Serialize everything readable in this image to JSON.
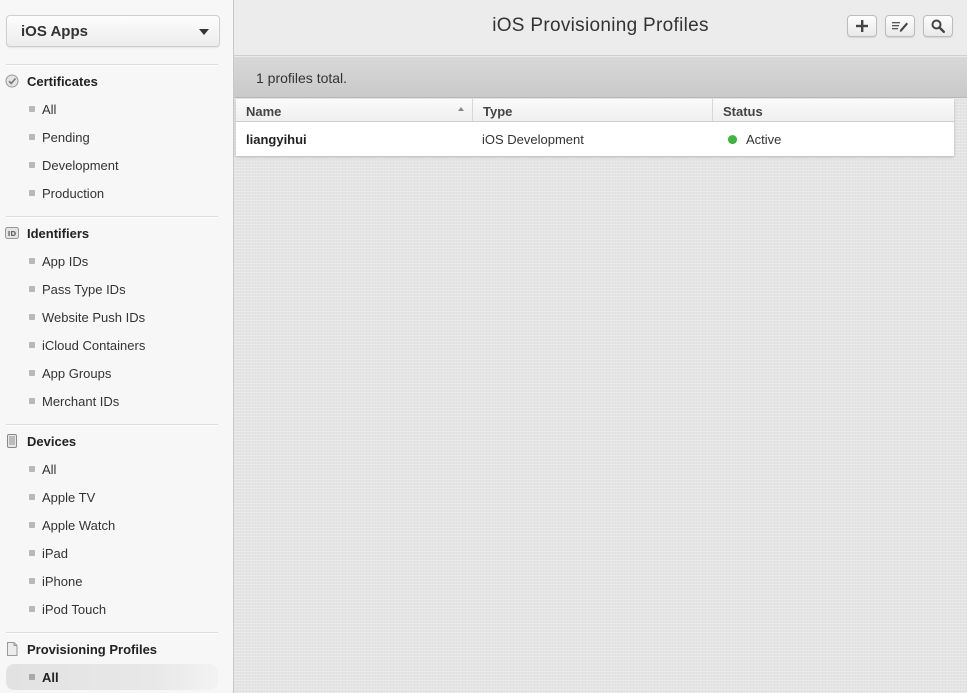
{
  "sidebar": {
    "app_select": "iOS Apps",
    "sections": [
      {
        "title": "Certificates",
        "icon": "certificate-icon",
        "items": [
          "All",
          "Pending",
          "Development",
          "Production"
        ]
      },
      {
        "title": "Identifiers",
        "icon": "id-badge-icon",
        "items": [
          "App IDs",
          "Pass Type IDs",
          "Website Push IDs",
          "iCloud Containers",
          "App Groups",
          "Merchant IDs"
        ]
      },
      {
        "title": "Devices",
        "icon": "device-icon",
        "items": [
          "All",
          "Apple TV",
          "Apple Watch",
          "iPad",
          "iPhone",
          "iPod Touch"
        ]
      },
      {
        "title": "Provisioning Profiles",
        "icon": "document-icon",
        "items": [
          "All"
        ]
      }
    ],
    "active": "Provisioning Profiles / All"
  },
  "header": {
    "title": "iOS Provisioning Profiles",
    "buttons": [
      "add-icon",
      "edit-icon",
      "search-icon"
    ]
  },
  "summary": {
    "text": "1 profiles total."
  },
  "table": {
    "columns": [
      "Name",
      "Type",
      "Status"
    ],
    "sorted_column": "Name",
    "rows": [
      {
        "name": "liangyihui",
        "type": "iOS Development",
        "status": "Active",
        "status_color": "#3cba3c"
      }
    ]
  }
}
